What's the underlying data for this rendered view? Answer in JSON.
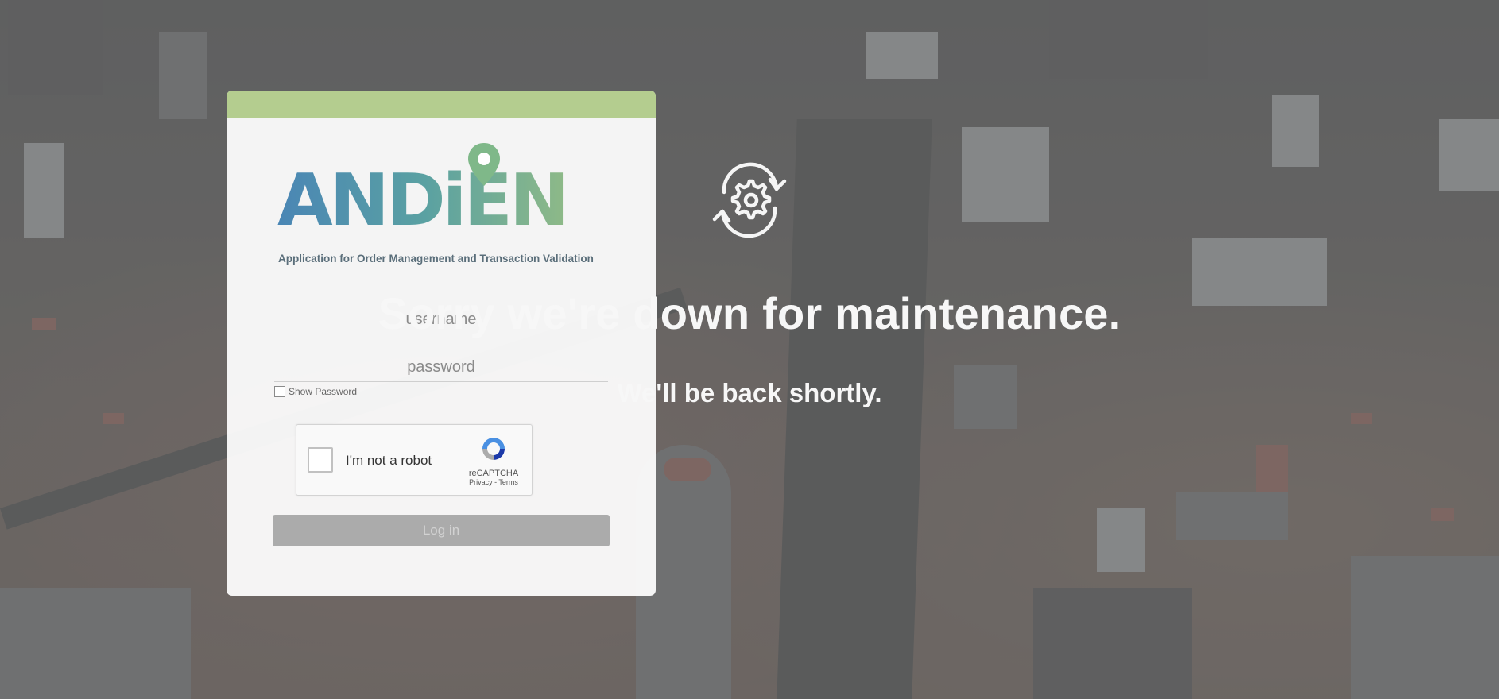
{
  "login": {
    "logo_text": "ANDiEN",
    "tagline": "Application for Order Management and Transaction Validation",
    "username_placeholder": "username",
    "password_placeholder": "password",
    "show_password_label": "Show Password",
    "captcha": {
      "label": "I'm not a robot",
      "brand": "reCAPTCHA",
      "links": "Privacy - Terms"
    },
    "login_button": "Log in"
  },
  "maintenance": {
    "icon": "gear-refresh-icon",
    "title": "Sorry we're down for maintenance.",
    "subtitle": "We'll be back shortly."
  },
  "colors": {
    "card_topbar": "#b4cd8f",
    "logo_blue": "#4a86b5",
    "logo_green": "#9cc080",
    "overlay": "#808080",
    "message_text": "#f7f7f7"
  }
}
